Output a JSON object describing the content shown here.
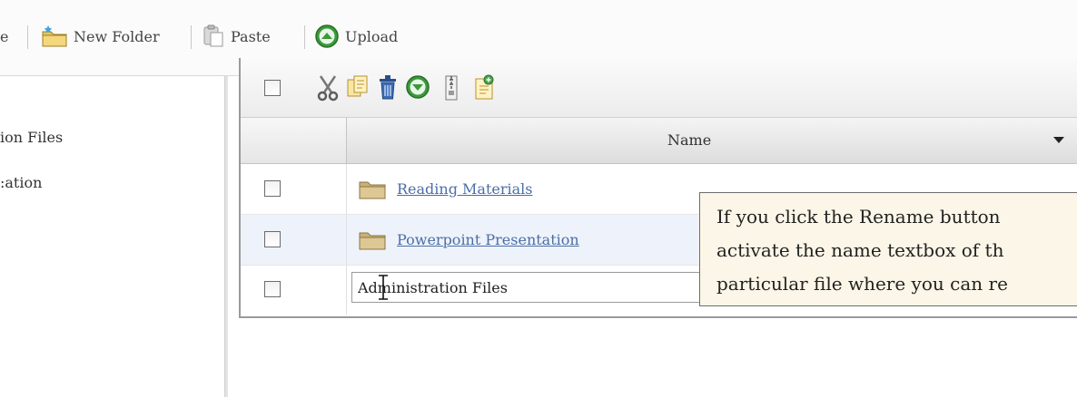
{
  "toolbar": {
    "partial_label": "e",
    "new_folder_label": "New Folder",
    "paste_label": "Paste",
    "upload_label": "Upload"
  },
  "sidebar": {
    "items": [
      {
        "label": "ion Files"
      },
      {
        "label": ":ation"
      }
    ]
  },
  "grid": {
    "header": {
      "name_label": "Name"
    },
    "rows": [
      {
        "name": "Reading Materials"
      },
      {
        "name": "Powerpoint Presentation"
      }
    ],
    "rename_value": "Administration Files"
  },
  "tooltip": {
    "lines": [
      "If you click the Rename button",
      "activate the name textbox of th",
      "particular file where you can re"
    ]
  },
  "colors": {
    "link": "#4a6fa5",
    "tooltip_bg": "#fbf6e7",
    "upload_green": "#3a9a3a",
    "folder_tan": "#c9b27a"
  }
}
